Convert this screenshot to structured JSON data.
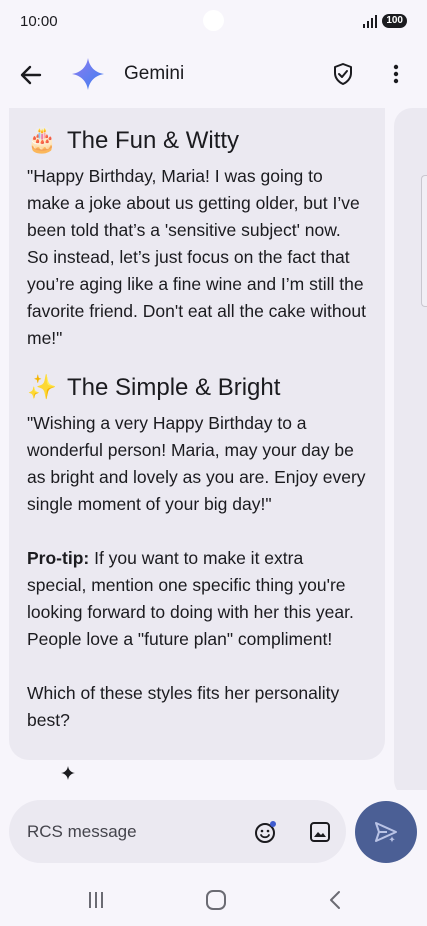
{
  "status_bar": {
    "time": "10:00",
    "battery": "100",
    "icons": [
      "signal-icon",
      "battery-icon"
    ]
  },
  "app_bar": {
    "title": "Gemini",
    "icons": [
      "back-arrow-icon",
      "gemini-sparkle-icon",
      "shield-check-icon",
      "more-vert-icon"
    ]
  },
  "message": {
    "sections": [
      {
        "emoji": "🎂",
        "heading": "The Fun & Witty",
        "text": "\"Happy Birthday, Maria! I was going to make a joke about us getting older, but I’ve been told that’s a 'sensitive subject' now. So instead, let’s just focus on the fact that you’re aging like a fine wine and I’m still the favorite friend. Don't eat all the cake without me!\""
      },
      {
        "emoji": "✨",
        "heading": "The Simple & Bright",
        "text": "\"Wishing a very Happy Birthday to a wonderful person! Maria, may your day be as bright and lovely as you are. Enjoy every single moment of your big day!\""
      }
    ],
    "protip_label": "Pro-tip:",
    "protip_text": " If you want to make it extra special, mention one specific thing you're looking forward to doing with her this year. People love a \"future plan\" compliment!",
    "question": "Which of these styles fits her personality best?"
  },
  "compose": {
    "placeholder": "RCS message",
    "icons": [
      "emoji-icon",
      "image-icon",
      "send-icon"
    ]
  },
  "colors": {
    "background": "#f7f5fb",
    "bubble": "#ebe9f1",
    "send_button": "#4b5f95",
    "text": "#1b1b1f"
  }
}
